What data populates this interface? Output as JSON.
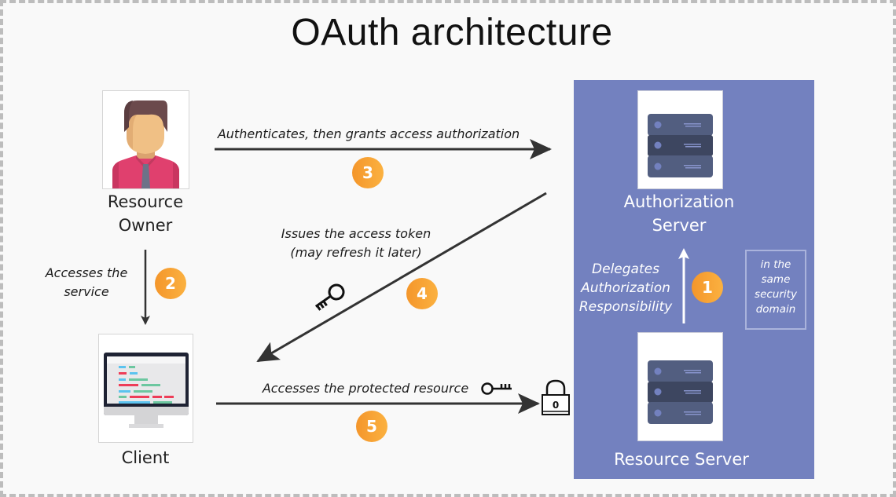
{
  "title": "OAuth architecture",
  "colors": {
    "panel": "#7381bf",
    "badge": "#f7a236",
    "arrow": "#333333",
    "border": "#bdbdbd"
  },
  "actors": {
    "resource_owner": {
      "label_line1": "Resource",
      "label_line2": "Owner",
      "icon": "person-icon"
    },
    "client": {
      "label": "Client",
      "icon": "desktop-monitor-icon"
    },
    "authorization_server": {
      "label_line1": "Authorization",
      "label_line2": "Server",
      "icon": "server-rack-icon"
    },
    "resource_server": {
      "label": "Resource Server",
      "icon": "server-rack-icon"
    }
  },
  "security_domain_note": {
    "line1": "in the",
    "line2": "same",
    "line3": "security",
    "line4": "domain"
  },
  "steps": [
    {
      "number": "1",
      "line1": "Delegates",
      "line2": "Authorization",
      "line3": "Responsibility"
    },
    {
      "number": "2",
      "line1": "Accesses the",
      "line2": "service"
    },
    {
      "number": "3",
      "line1": "Authenticates, then grants access authorization"
    },
    {
      "number": "4",
      "line1": "Issues the access token",
      "line2": "(may refresh it later)",
      "icon": "key-icon"
    },
    {
      "number": "5",
      "line1": "Accesses the protected resource",
      "icon": "key-icon",
      "target_icon": "padlock-icon"
    }
  ]
}
